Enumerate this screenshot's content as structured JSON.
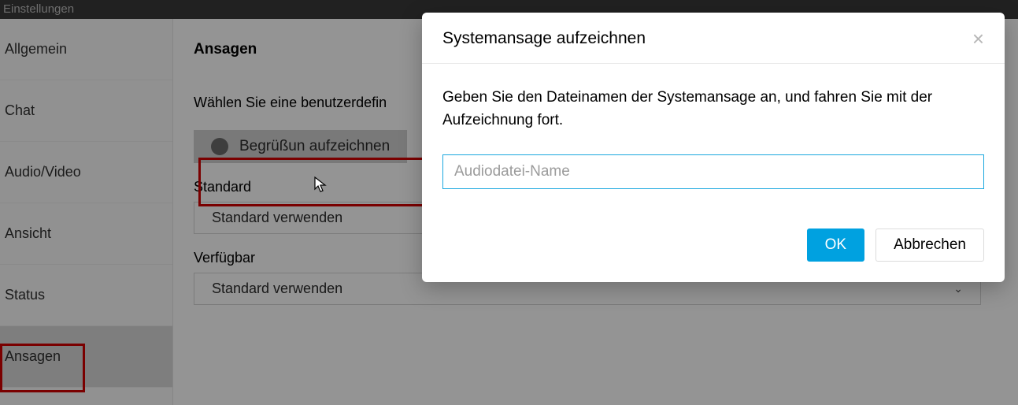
{
  "titlebar": {
    "title": "Einstellungen"
  },
  "sidebar": {
    "items": [
      {
        "label": "Allgemein"
      },
      {
        "label": "Chat"
      },
      {
        "label": "Audio/Video"
      },
      {
        "label": "Ansicht"
      },
      {
        "label": "Status"
      },
      {
        "label": "Ansagen"
      }
    ]
  },
  "main": {
    "heading": "Ansagen",
    "instruction": "Wählen Sie eine benutzerdefin",
    "record_button": "Begrüßun    aufzeichnen",
    "sections": {
      "0": {
        "label": "Standard",
        "value": "Standard verwenden"
      },
      "1": {
        "label": "Verfügbar",
        "value": "Standard verwenden"
      }
    }
  },
  "modal": {
    "title": "Systemansage aufzeichnen",
    "message": "Geben Sie den Dateinamen der Systemansage an, und fahren Sie mit der Aufzeichnung fort.",
    "input_placeholder": "Audiodatei-Name",
    "input_value": "",
    "ok": "OK",
    "cancel": "Abbrechen"
  }
}
